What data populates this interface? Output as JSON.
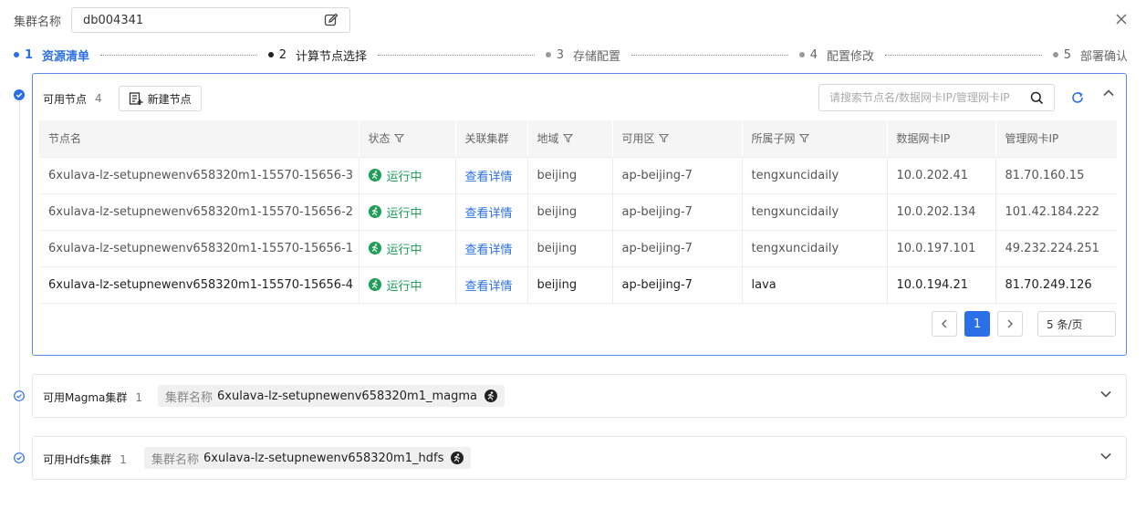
{
  "header": {
    "cluster_label": "集群名称",
    "cluster_name": "db004341"
  },
  "steps": [
    {
      "num": "1",
      "label": "资源清单"
    },
    {
      "num": "2",
      "label": "计算节点选择"
    },
    {
      "num": "3",
      "label": "存储配置"
    },
    {
      "num": "4",
      "label": "配置修改"
    },
    {
      "num": "5",
      "label": "部署确认"
    }
  ],
  "nodes_panel": {
    "title": "可用节点",
    "count": "4",
    "new_button": "新建节点",
    "search_placeholder": "请搜索节点名/数据网卡IP/管理网卡IP",
    "columns": [
      "节点名",
      "状态",
      "关联集群",
      "地域",
      "可用区",
      "所属子网",
      "数据网卡IP",
      "管理网卡IP"
    ],
    "rows": [
      {
        "name": "6xulava-lz-setupnewenv658320m1-15570-15656-3",
        "status": "运行中",
        "cluster": "查看详情",
        "region": "beijing",
        "zone": "ap-beijing-7",
        "subnet": "tengxuncidaily",
        "data_ip": "10.0.202.41",
        "mgmt_ip": "81.70.160.15"
      },
      {
        "name": "6xulava-lz-setupnewenv658320m1-15570-15656-2",
        "status": "运行中",
        "cluster": "查看详情",
        "region": "beijing",
        "zone": "ap-beijing-7",
        "subnet": "tengxuncidaily",
        "data_ip": "10.0.202.134",
        "mgmt_ip": "101.42.184.222"
      },
      {
        "name": "6xulava-lz-setupnewenv658320m1-15570-15656-1",
        "status": "运行中",
        "cluster": "查看详情",
        "region": "beijing",
        "zone": "ap-beijing-7",
        "subnet": "tengxuncidaily",
        "data_ip": "10.0.197.101",
        "mgmt_ip": "49.232.224.251"
      },
      {
        "name": "6xulava-lz-setupnewenv658320m1-15570-15656-4",
        "status": "运行中",
        "cluster": "查看详情",
        "region": "beijing",
        "zone": "ap-beijing-7",
        "subnet": "lava",
        "data_ip": "10.0.194.21",
        "mgmt_ip": "81.70.249.126"
      }
    ],
    "pagination": {
      "current_page": "1",
      "page_size": "5 条/页"
    }
  },
  "magma_panel": {
    "title": "可用Magma集群",
    "count": "1",
    "tag_key": "集群名称",
    "tag_value": "6xulava-lz-setupnewenv658320m1_magma"
  },
  "hdfs_panel": {
    "title": "可用Hdfs集群",
    "count": "1",
    "tag_key": "集群名称",
    "tag_value": "6xulava-lz-setupnewenv658320m1_hdfs"
  },
  "colors": {
    "accent": "#2a6fe8",
    "running": "#1f9e57"
  }
}
